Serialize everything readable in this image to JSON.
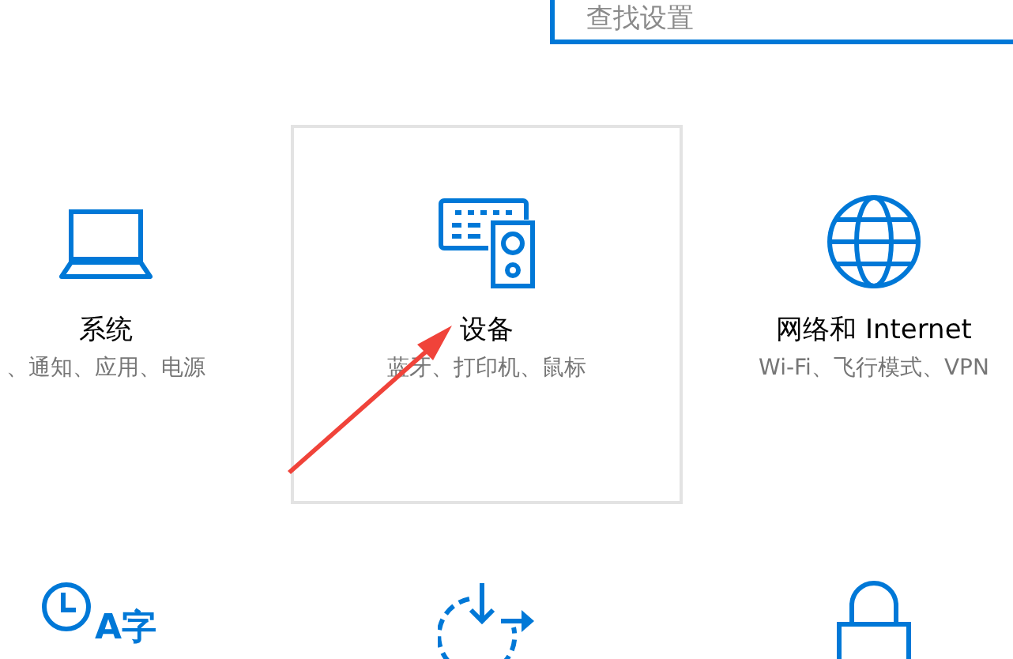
{
  "search": {
    "placeholder": "查找设置"
  },
  "tiles": [
    {
      "kind": "system",
      "title": "系统",
      "subtitle": "、通知、应用、电源",
      "hovered": false
    },
    {
      "kind": "devices",
      "title": "设备",
      "subtitle": "蓝牙、打印机、鼠标",
      "hovered": true
    },
    {
      "kind": "network",
      "title": "网络和 Internet",
      "subtitle": "Wi-Fi、飞行模式、VPN",
      "hovered": false
    },
    {
      "kind": "time-language",
      "icon_text": "A字",
      "hovered": false
    },
    {
      "kind": "update",
      "hovered": false
    },
    {
      "kind": "lock",
      "hovered": false
    }
  ]
}
